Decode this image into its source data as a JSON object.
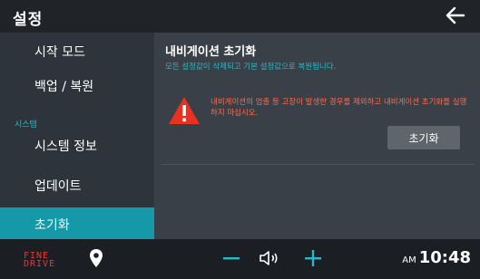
{
  "header": {
    "title": "설정"
  },
  "sidebar": {
    "items": [
      {
        "label": "시작 모드"
      },
      {
        "label": "백업 / 복원"
      },
      {
        "label": "시스템 정보"
      },
      {
        "label": "업데이트"
      },
      {
        "label": "초기화"
      }
    ],
    "section_label": "시스템",
    "active_index": 4
  },
  "main": {
    "title": "내비게이션 초기화",
    "subtitle": "모든 설정값이 삭제되고 기본 설정값으로 복원됩니다.",
    "warning": "내비게이션의 엄출 등 고장이 발생한 경우를 제외하고 내비게이션 초기화를 실행하지 마십시오.",
    "reset_button": "초기화"
  },
  "bottombar": {
    "logo_line1": "FINE",
    "logo_line2": "DRIVE",
    "ampm": "AM",
    "time": "10:48"
  },
  "colors": {
    "accent": "#1598a8",
    "teal_text": "#2bb8c8",
    "warning": "#ff6a4a",
    "volume": "#2bb8c8"
  }
}
